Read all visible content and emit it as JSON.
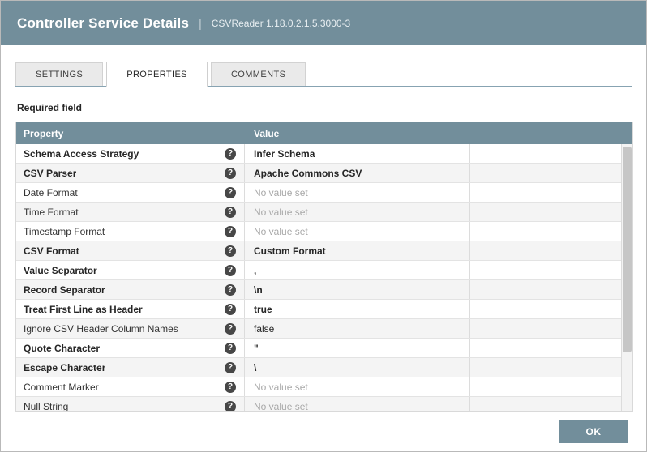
{
  "header": {
    "title": "Controller Service Details",
    "separator": "|",
    "subtitle": "CSVReader 1.18.0.2.1.5.3000-3"
  },
  "tabs": [
    {
      "label": "SETTINGS",
      "active": false
    },
    {
      "label": "PROPERTIES",
      "active": true
    },
    {
      "label": "COMMENTS",
      "active": false
    }
  ],
  "required_field_label": "Required field",
  "table": {
    "columns": [
      "Property",
      "Value"
    ],
    "help_icon": "?",
    "rows": [
      {
        "property": "Schema Access Strategy",
        "value": "Infer Schema",
        "required": true,
        "unset": false
      },
      {
        "property": "CSV Parser",
        "value": "Apache Commons CSV",
        "required": true,
        "unset": false
      },
      {
        "property": "Date Format",
        "value": "No value set",
        "required": false,
        "unset": true
      },
      {
        "property": "Time Format",
        "value": "No value set",
        "required": false,
        "unset": true
      },
      {
        "property": "Timestamp Format",
        "value": "No value set",
        "required": false,
        "unset": true
      },
      {
        "property": "CSV Format",
        "value": "Custom Format",
        "required": true,
        "unset": false
      },
      {
        "property": "Value Separator",
        "value": ",",
        "required": true,
        "unset": false
      },
      {
        "property": "Record Separator",
        "value": "\\n",
        "required": true,
        "unset": false
      },
      {
        "property": "Treat First Line as Header",
        "value": "true",
        "required": true,
        "unset": false
      },
      {
        "property": "Ignore CSV Header Column Names",
        "value": "false",
        "required": false,
        "unset": false
      },
      {
        "property": "Quote Character",
        "value": "\"",
        "required": true,
        "unset": false
      },
      {
        "property": "Escape Character",
        "value": "\\",
        "required": true,
        "unset": false
      },
      {
        "property": "Comment Marker",
        "value": "No value set",
        "required": false,
        "unset": true
      },
      {
        "property": "Null String",
        "value": "No value set",
        "required": false,
        "unset": true
      }
    ]
  },
  "footer": {
    "ok_label": "OK"
  },
  "colors": {
    "header_bg": "#728e9b",
    "tab_underline": "#87a3b2",
    "row_alt_bg": "#f4f4f4",
    "unset_text": "#a8a8a8",
    "ok_button_bg": "#728e9b"
  }
}
